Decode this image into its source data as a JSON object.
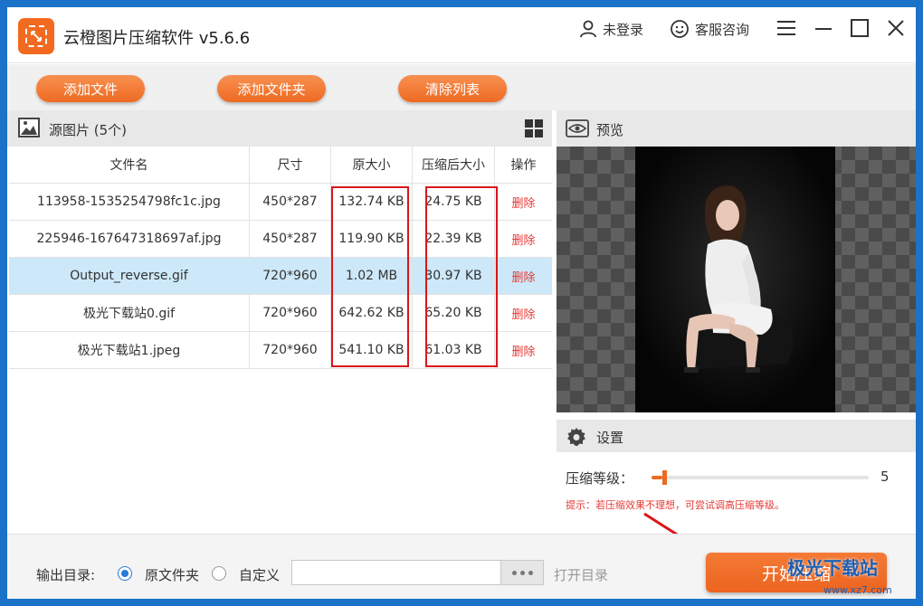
{
  "app": {
    "title": "云橙图片压缩软件 v5.6.6",
    "login_label": "未登录",
    "service_label": "客服咨询",
    "accent": "#ee6a22"
  },
  "toolbar": {
    "add_file": "添加文件",
    "add_folder": "添加文件夹",
    "clear_list": "清除列表"
  },
  "source": {
    "title": "源图片 (5个)",
    "columns": [
      "文件名",
      "尺寸",
      "原大小",
      "压缩后大小",
      "操作"
    ],
    "rows": [
      {
        "name": "113958-1535254798fc1c.jpg",
        "size": "450*287",
        "original": "132.74 KB",
        "compressed": "24.75 KB",
        "action": "删除"
      },
      {
        "name": "225946-167647318697af.jpg",
        "size": "450*287",
        "original": "119.90 KB",
        "compressed": "22.39 KB",
        "action": "删除"
      },
      {
        "name": "Output_reverse.gif",
        "size": "720*960",
        "original": "1.02 MB",
        "compressed": "30.97 KB",
        "action": "删除"
      },
      {
        "name": "极光下载站0.gif",
        "size": "720*960",
        "original": "642.62 KB",
        "compressed": "65.20 KB",
        "action": "删除"
      },
      {
        "name": "极光下载站1.jpeg",
        "size": "720*960",
        "original": "541.10 KB",
        "compressed": "61.03 KB",
        "action": "删除"
      }
    ],
    "selected_row": 2
  },
  "preview": {
    "title": "预览"
  },
  "settings": {
    "title": "设置",
    "level_label": "压缩等级：",
    "level_value": "5",
    "level_fraction": 0.05,
    "hint": "提示：若压缩效果不理想，可尝试调高压缩等级。"
  },
  "output": {
    "label": "输出目录:",
    "option_original": "原文件夹",
    "option_custom": "自定义",
    "path_value": "",
    "open_dir": "打开目录",
    "start": "开始压缩"
  },
  "watermark": {
    "text": "极光下载站",
    "url": "www.xz7.com"
  }
}
